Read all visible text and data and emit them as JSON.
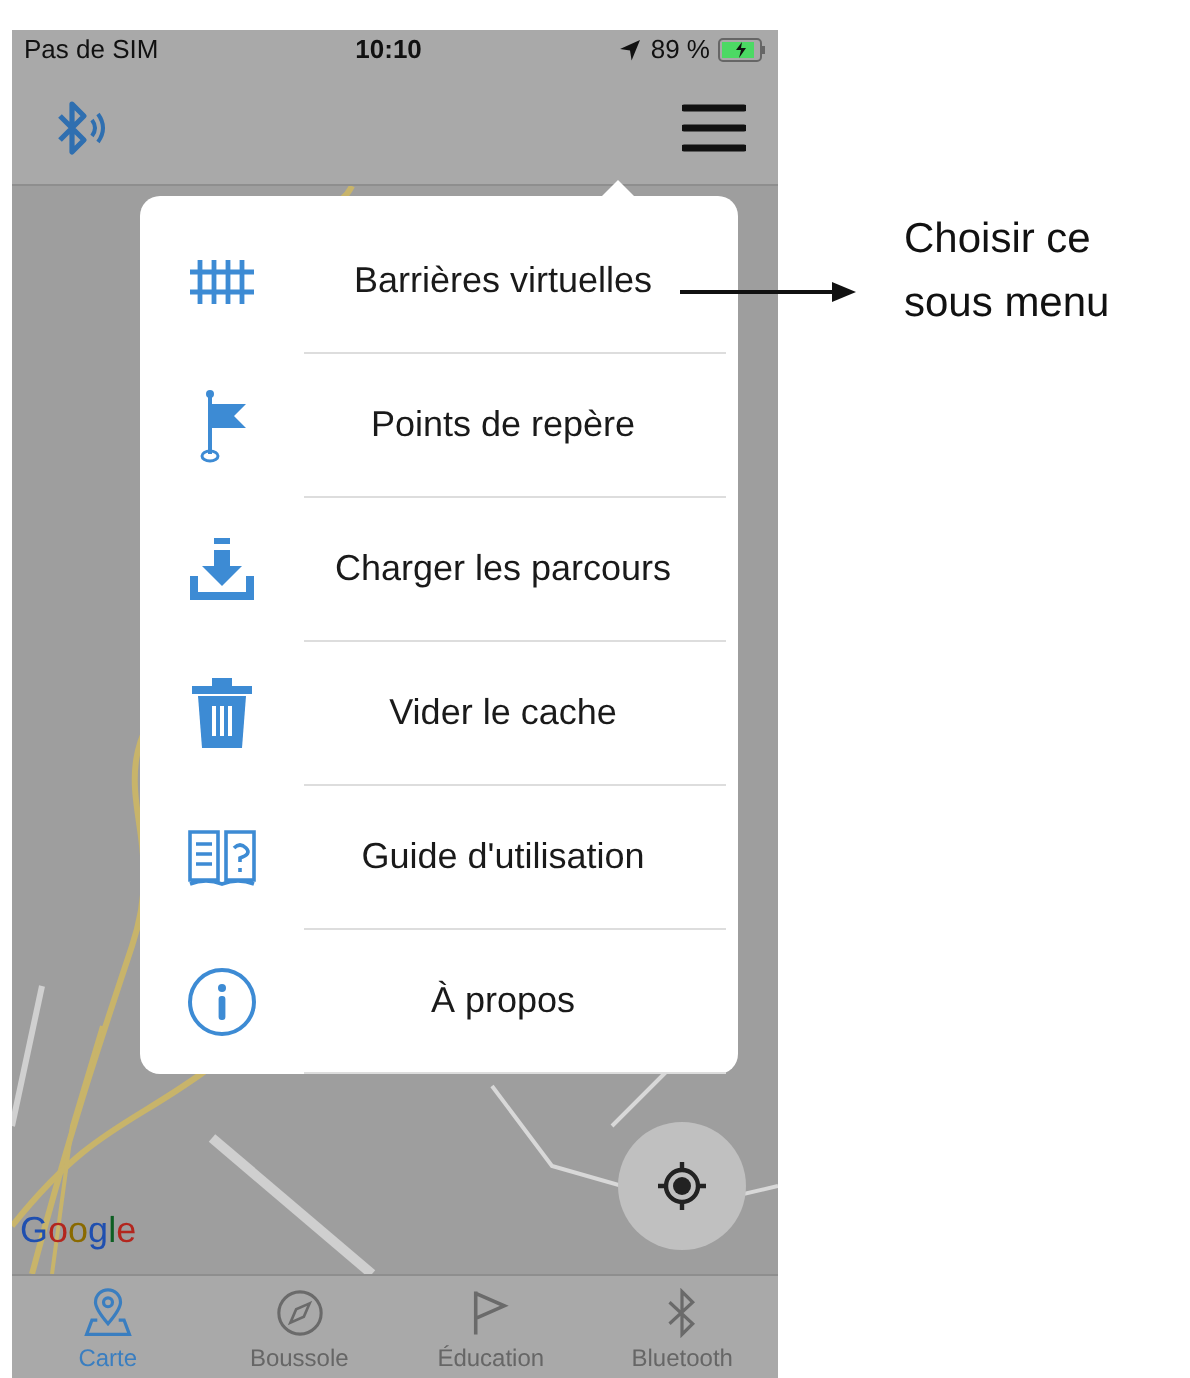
{
  "status_bar": {
    "carrier": "Pas de SIM",
    "time": "10:10",
    "battery": "89 %"
  },
  "menu": {
    "items": [
      {
        "kind": "fence",
        "label": "Barrières virtuelles"
      },
      {
        "kind": "flag",
        "label": "Points de repère"
      },
      {
        "kind": "download",
        "label": "Charger les parcours"
      },
      {
        "kind": "trash",
        "label": "Vider le cache"
      },
      {
        "kind": "guide",
        "label": "Guide d'utilisation"
      },
      {
        "kind": "info",
        "label": "À propos"
      }
    ]
  },
  "map": {
    "logo": "Google"
  },
  "tabs": [
    {
      "kind": "map",
      "label": "Carte",
      "selected": true
    },
    {
      "kind": "compass",
      "label": "Boussole",
      "selected": false
    },
    {
      "kind": "flag",
      "label": "Éducation",
      "selected": false
    },
    {
      "kind": "bluetooth",
      "label": "Bluetooth",
      "selected": false
    }
  ],
  "annotation": {
    "text": "Choisir ce sous menu"
  }
}
